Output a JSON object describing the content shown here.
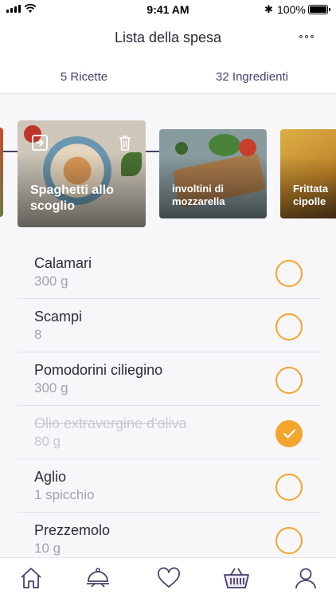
{
  "status_bar": {
    "time": "9:41 AM",
    "battery": "100%",
    "battery_level": 1.0,
    "bluetooth_icon": "bluetooth-icon"
  },
  "header": {
    "title": "Lista della spesa",
    "more_icon": "more-options-icon"
  },
  "tabs": [
    {
      "label": "5 Ricette",
      "active": true
    },
    {
      "label": "32 Ingredienti",
      "active": false
    }
  ],
  "recipes": [
    {
      "title": ""
    },
    {
      "title": "Spaghetti allo scoglio",
      "open_icon": "open-recipe-icon",
      "delete_icon": "trash-icon"
    },
    {
      "title": "involtini di mozzarella"
    },
    {
      "title": "Frittata cipolle"
    }
  ],
  "ingredients": [
    {
      "name": "Calamari",
      "qty": "300 g",
      "checked": false
    },
    {
      "name": "Scampi",
      "qty": "8",
      "checked": false
    },
    {
      "name": "Pomodorini ciliegino",
      "qty": "300 g",
      "checked": false
    },
    {
      "name": "Olio extravergine d'oliva",
      "qty": "80 g",
      "checked": true
    },
    {
      "name": "Aglio",
      "qty": "1 spicchio",
      "checked": false
    },
    {
      "name": "Prezzemolo",
      "qty": "10 g",
      "checked": false
    }
  ],
  "bottom_nav": [
    {
      "icon": "home-icon"
    },
    {
      "icon": "chef-cloche-icon"
    },
    {
      "icon": "heart-icon"
    },
    {
      "icon": "basket-icon",
      "active": true
    },
    {
      "icon": "profile-icon"
    }
  ],
  "colors": {
    "accent": "#4a3f6b",
    "check": "#f3a52c",
    "background": "#f7f6f9"
  }
}
